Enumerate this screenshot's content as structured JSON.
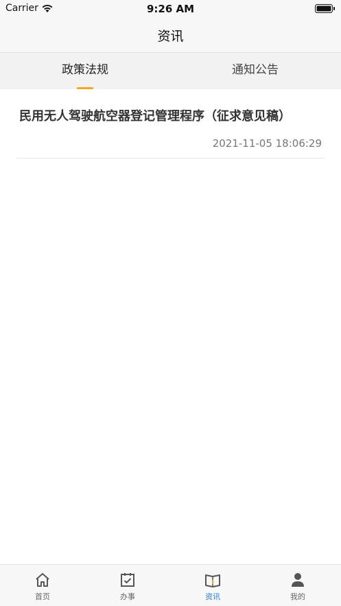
{
  "status_bar": {
    "carrier": "Carrier",
    "time": "9:26 AM"
  },
  "nav": {
    "title": "资讯"
  },
  "tabs": [
    {
      "label": "政策法规",
      "active": true
    },
    {
      "label": "通知公告",
      "active": false
    }
  ],
  "articles": [
    {
      "title": "民用无人驾驶航空器登记管理程序（征求意见稿）",
      "time": "2021-11-05 18:06:29"
    }
  ],
  "tab_bar": {
    "items": [
      {
        "label": "首页",
        "icon": "home-icon"
      },
      {
        "label": "办事",
        "icon": "calendar-check-icon"
      },
      {
        "label": "资讯",
        "icon": "book-icon",
        "active": true
      },
      {
        "label": "我的",
        "icon": "person-icon"
      }
    ]
  },
  "colors": {
    "accent": "#f5a623",
    "active_tab": "#2a7fd4"
  }
}
